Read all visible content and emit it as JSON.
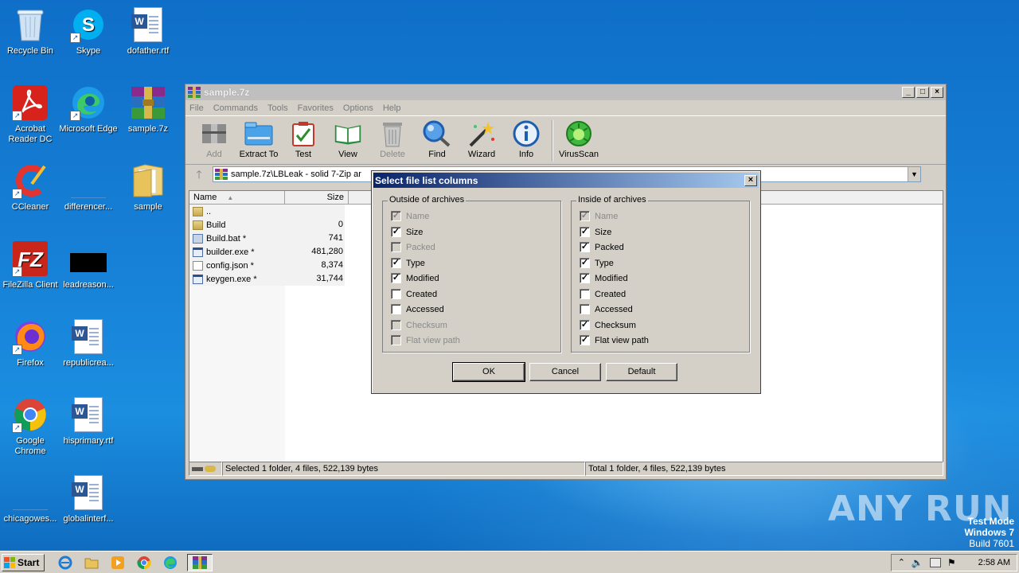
{
  "desktop": {
    "icons": [
      {
        "label": "Recycle Bin"
      },
      {
        "label": "Skype"
      },
      {
        "label": "dofather.rtf"
      },
      {
        "label": "Acrobat Reader DC"
      },
      {
        "label": "Microsoft Edge"
      },
      {
        "label": "sample.7z"
      },
      {
        "label": "CCleaner"
      },
      {
        "label": "differencer..."
      },
      {
        "label": "sample"
      },
      {
        "label": "FileZilla Client"
      },
      {
        "label": "leadreason..."
      },
      {
        "label": "Firefox"
      },
      {
        "label": "republicrea..."
      },
      {
        "label": "Google Chrome"
      },
      {
        "label": "hisprimary.rtf"
      },
      {
        "label": "chicagowes..."
      },
      {
        "label": "globalinterf..."
      }
    ]
  },
  "app": {
    "title": "sample.7z",
    "menu": [
      "File",
      "Commands",
      "Tools",
      "Favorites",
      "Options",
      "Help"
    ],
    "toolbar": [
      {
        "label": "Add",
        "icon": "add-icon",
        "disabled": true
      },
      {
        "label": "Extract To",
        "icon": "extract-icon",
        "disabled": false
      },
      {
        "label": "Test",
        "icon": "test-icon",
        "disabled": false
      },
      {
        "label": "View",
        "icon": "view-icon",
        "disabled": false
      },
      {
        "label": "Delete",
        "icon": "delete-icon",
        "disabled": true
      },
      {
        "label": "Find",
        "icon": "find-icon",
        "disabled": false
      },
      {
        "label": "Wizard",
        "icon": "wizard-icon",
        "disabled": false
      },
      {
        "label": "Info",
        "icon": "info-icon",
        "disabled": false
      },
      {
        "label": "VirusScan",
        "icon": "virusscan-icon",
        "disabled": false
      }
    ],
    "address": "sample.7z\\LBLeak - solid 7-Zip ar",
    "columns": {
      "name": "Name",
      "size": "Size"
    },
    "files": [
      {
        "name": "..",
        "size": "",
        "type": "folder"
      },
      {
        "name": "Build",
        "size": "0",
        "type": "folder"
      },
      {
        "name": "Build.bat *",
        "size": "741",
        "type": "bat"
      },
      {
        "name": "builder.exe *",
        "size": "481,280",
        "type": "exe"
      },
      {
        "name": "config.json *",
        "size": "8,374",
        "type": "json"
      },
      {
        "name": "keygen.exe *",
        "size": "31,744",
        "type": "exe"
      }
    ],
    "status_left": "Selected 1 folder, 4 files, 522,139 bytes",
    "status_right": "Total 1 folder, 4 files, 522,139 bytes"
  },
  "dialog": {
    "title": "Select file list columns",
    "close": "×",
    "outside": {
      "title": "Outside of archives",
      "options": [
        {
          "label": "Name",
          "checked": true,
          "disabled": true
        },
        {
          "label": "Size",
          "checked": true,
          "disabled": false
        },
        {
          "label": "Packed",
          "checked": false,
          "disabled": true
        },
        {
          "label": "Type",
          "checked": true,
          "disabled": false
        },
        {
          "label": "Modified",
          "checked": true,
          "disabled": false
        },
        {
          "label": "Created",
          "checked": false,
          "disabled": false
        },
        {
          "label": "Accessed",
          "checked": false,
          "disabled": false
        },
        {
          "label": "Checksum",
          "checked": false,
          "disabled": true
        },
        {
          "label": "Flat view path",
          "checked": false,
          "disabled": true
        }
      ]
    },
    "inside": {
      "title": "Inside of archives",
      "options": [
        {
          "label": "Name",
          "checked": true,
          "disabled": true
        },
        {
          "label": "Size",
          "checked": true,
          "disabled": false
        },
        {
          "label": "Packed",
          "checked": true,
          "disabled": false
        },
        {
          "label": "Type",
          "checked": true,
          "disabled": false
        },
        {
          "label": "Modified",
          "checked": true,
          "disabled": false
        },
        {
          "label": "Created",
          "checked": false,
          "disabled": false
        },
        {
          "label": "Accessed",
          "checked": false,
          "disabled": false
        },
        {
          "label": "Checksum",
          "checked": true,
          "disabled": false
        },
        {
          "label": "Flat view path",
          "checked": true,
          "disabled": false
        }
      ]
    },
    "buttons": {
      "ok": "OK",
      "cancel": "Cancel",
      "default": "Default"
    }
  },
  "watermark": "ANY RUN",
  "testmode": {
    "line1": "Test Mode",
    "line2": "Windows 7",
    "line3": "Build 7601"
  },
  "taskbar": {
    "start": "Start",
    "clock": "2:58 AM"
  }
}
